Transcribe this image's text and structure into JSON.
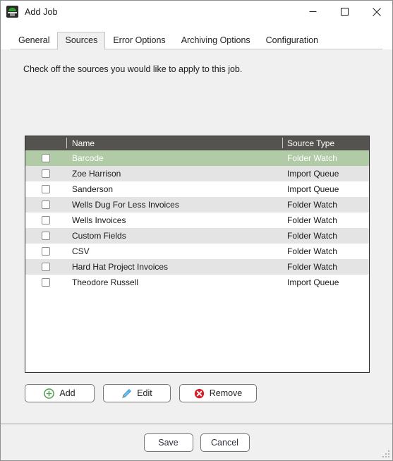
{
  "window": {
    "title": "Add Job",
    "app_icon": "satellite-dish-icon",
    "controls": {
      "minimize": "minimize-icon",
      "maximize": "maximize-icon",
      "close": "close-icon"
    }
  },
  "tabs": [
    {
      "label": "General",
      "selected": false
    },
    {
      "label": "Sources",
      "selected": true
    },
    {
      "label": "Error Options",
      "selected": false
    },
    {
      "label": "Archiving Options",
      "selected": false
    },
    {
      "label": "Configuration",
      "selected": false
    }
  ],
  "main": {
    "instruction": "Check off the sources you would like to apply to this job."
  },
  "grid": {
    "columns": [
      {
        "key": "check",
        "label": ""
      },
      {
        "key": "name",
        "label": "Name"
      },
      {
        "key": "type",
        "label": "Source Type"
      },
      {
        "key": "extra",
        "label": ""
      }
    ],
    "rows": [
      {
        "checked": false,
        "name": "Barcode",
        "type": "Folder Watch",
        "selected": true
      },
      {
        "checked": false,
        "name": "Zoe Harrison",
        "type": "Import Queue",
        "selected": false
      },
      {
        "checked": false,
        "name": "Sanderson",
        "type": "Import Queue",
        "selected": false
      },
      {
        "checked": false,
        "name": "Wells Dug For Less Invoices",
        "type": "Folder Watch",
        "selected": false
      },
      {
        "checked": false,
        "name": "Wells Invoices",
        "type": "Folder Watch",
        "selected": false
      },
      {
        "checked": false,
        "name": "Custom Fields",
        "type": "Folder Watch",
        "selected": false
      },
      {
        "checked": false,
        "name": "CSV",
        "type": "Folder Watch",
        "selected": false
      },
      {
        "checked": false,
        "name": "Hard Hat Project Invoices",
        "type": "Folder Watch",
        "selected": false
      },
      {
        "checked": false,
        "name": "Theodore Russell",
        "type": "Import Queue",
        "selected": false
      }
    ]
  },
  "actions": {
    "add": {
      "label": "Add",
      "icon": "plus-circle-icon",
      "color": "#4f9d4f"
    },
    "edit": {
      "label": "Edit",
      "icon": "pencil-icon",
      "color": "#4aa3df"
    },
    "remove": {
      "label": "Remove",
      "icon": "x-circle-icon",
      "color": "#d91e2a"
    }
  },
  "footer": {
    "save": "Save",
    "cancel": "Cancel"
  },
  "colors": {
    "selection_green": "#b0cba6",
    "header_gray": "#54534f",
    "alt_row": "#e4e4e4",
    "dialog_bg": "#f0f0f0"
  }
}
